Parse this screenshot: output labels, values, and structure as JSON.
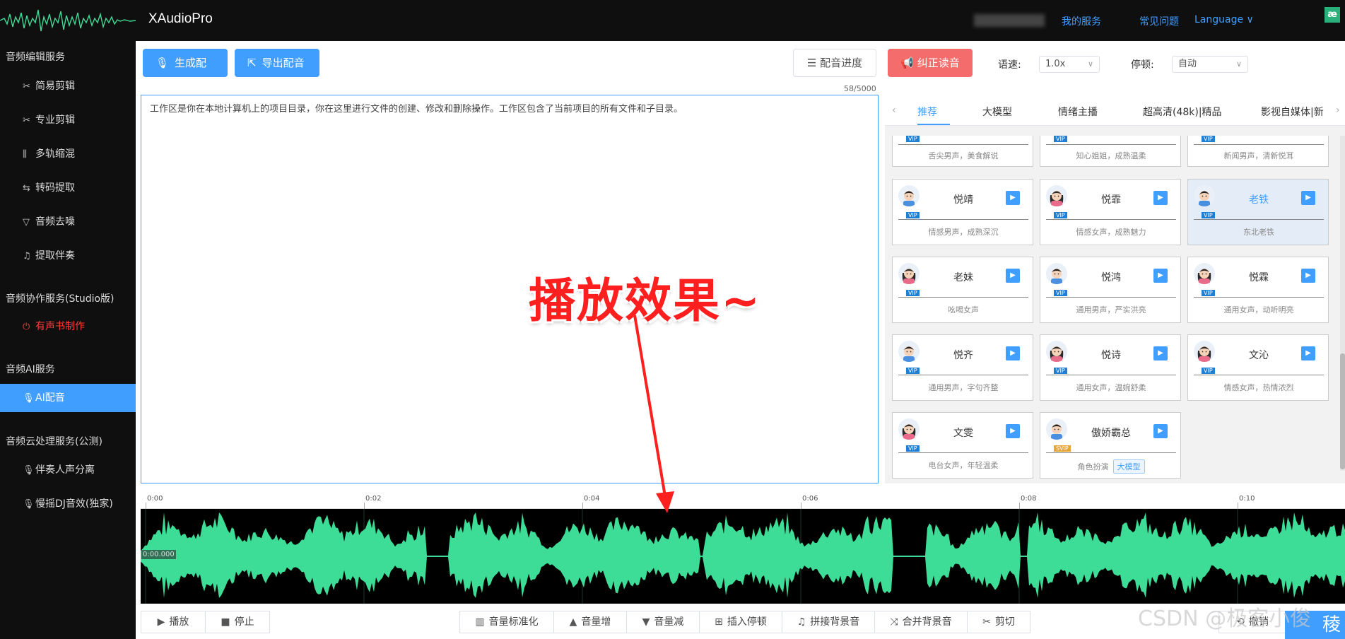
{
  "header": {
    "app_title": "XAudioPro",
    "links": {
      "my_service": "我的服务",
      "faq": "常见问题",
      "language": "Language ∨"
    },
    "badge": "æ"
  },
  "sidebar": {
    "sections": [
      {
        "title": "音频编辑服务",
        "items": [
          {
            "label": "简易剪辑",
            "icon": "scissors-icon"
          },
          {
            "label": "专业剪辑",
            "icon": "scissors-icon"
          },
          {
            "label": "多轨缩混",
            "icon": "sliders-icon"
          },
          {
            "label": "转码提取",
            "icon": "swap-icon"
          },
          {
            "label": "音频去噪",
            "icon": "filter-icon"
          },
          {
            "label": "提取伴奏",
            "icon": "headphones-icon"
          }
        ]
      },
      {
        "title": "音频协作服务(Studio版)",
        "items": [
          {
            "label": "有声书制作",
            "icon": "power-icon"
          }
        ]
      },
      {
        "title": "音频AI服务",
        "items": [
          {
            "label": "AI配音",
            "icon": "mic-icon"
          }
        ]
      },
      {
        "title": "音频云处理服务(公测)",
        "items": [
          {
            "label": "伴奏人声分离",
            "icon": "mic-icon"
          },
          {
            "label": "慢摇DJ音效(独家)",
            "icon": "mic-icon"
          }
        ]
      }
    ]
  },
  "toolbar": {
    "generate": "生成配音",
    "export": "导出配音",
    "progress": "配音进度",
    "correct": "纠正读音",
    "speed_label": "语速:",
    "speed_value": "1.0x",
    "pause_label": "停顿:",
    "pause_value": "自动"
  },
  "editor": {
    "counter": "58/5000",
    "text": "工作区是你在本地计算机上的项目目录，你在这里进行文件的创建、修改和删除操作。工作区包含了当前项目的所有文件和子目录。"
  },
  "voice_tabs": [
    "推荐",
    "大模型",
    "情绪主播",
    "超高清(48k)|精品",
    "影视自媒体|新"
  ],
  "voice_cards_top": [
    {
      "desc": "舌尖男声，美食解说",
      "badge": "VIP"
    },
    {
      "desc": "知心姐姐，成熟温柔",
      "badge": "VIP"
    },
    {
      "desc": "新闻男声，清新悦耳",
      "badge": "VIP"
    }
  ],
  "voice_cards": [
    {
      "name": "悦靖",
      "desc": "情感男声，成熟深沉",
      "badge": "VIP",
      "gender": "m",
      "selected": false
    },
    {
      "name": "悦霏",
      "desc": "情感女声，成熟魅力",
      "badge": "VIP",
      "gender": "f",
      "selected": false
    },
    {
      "name": "老铁",
      "desc": "东北老铁",
      "badge": "VIP",
      "gender": "m",
      "selected": true
    },
    {
      "name": "老妹",
      "desc": "吆喝女声",
      "badge": "VIP",
      "gender": "f",
      "selected": false
    },
    {
      "name": "悦鸿",
      "desc": "通用男声，严实洪亮",
      "badge": "VIP",
      "gender": "m",
      "selected": false
    },
    {
      "name": "悦霖",
      "desc": "通用女声，动听明亮",
      "badge": "VIP",
      "gender": "f",
      "selected": false
    },
    {
      "name": "悦齐",
      "desc": "通用男声，字句齐整",
      "badge": "VIP",
      "gender": "m",
      "selected": false
    },
    {
      "name": "悦诗",
      "desc": "通用女声，温婉舒柔",
      "badge": "VIP",
      "gender": "f",
      "selected": false
    },
    {
      "name": "文沁",
      "desc": "情感女声，热情浓烈",
      "badge": "VIP",
      "gender": "f2",
      "selected": false
    },
    {
      "name": "文雯",
      "desc": "电台女声，年轻温柔",
      "badge": "VIP",
      "gender": "f2",
      "selected": false
    },
    {
      "name": "傲娇霸总",
      "desc": "角色扮演",
      "badge": "SVIP",
      "gender": "m",
      "selected": false,
      "tag": "大模型"
    }
  ],
  "timeline": {
    "ticks": [
      "0:00",
      "0:02",
      "0:04",
      "0:06",
      "0:08",
      "0:10"
    ],
    "current_time": "0:00.000"
  },
  "bottom_bar": {
    "play": "播放",
    "stop": "停止",
    "normalize": "音量标准化",
    "vol_up": "音量增",
    "vol_down": "音量减",
    "insert_pause": "插入停顿",
    "splice_bg": "拼接背景音",
    "merge_bg": "合并背景音",
    "cut": "剪切",
    "extra": "撤销",
    "corner_text": "稜"
  },
  "annotation": {
    "text": "播放效果~"
  },
  "watermark": "CSDN @极客小俊",
  "colors": {
    "primary": "#409eff",
    "danger": "#f56c6c",
    "waveform": "#3ddc97",
    "sidebar_bg": "#0f0f0f"
  }
}
